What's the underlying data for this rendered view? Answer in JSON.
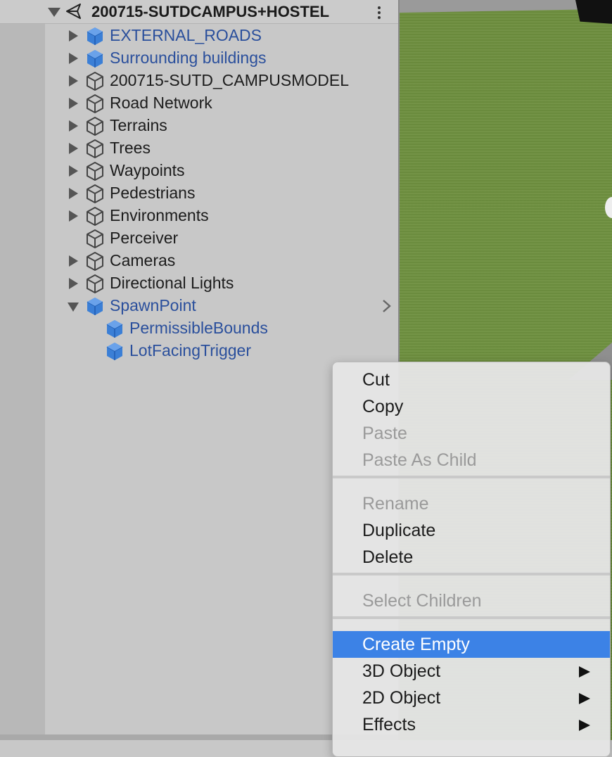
{
  "hierarchy": {
    "scene_title": "200715-SUTDCAMPUS+HOSTEL",
    "items": [
      {
        "label": "EXTERNAL_ROADS",
        "prefab": true,
        "expander": "right",
        "depth": 0
      },
      {
        "label": "Surrounding buildings",
        "prefab": true,
        "expander": "right",
        "depth": 0
      },
      {
        "label": "200715-SUTD_CAMPUSMODEL",
        "prefab": false,
        "expander": "right",
        "depth": 0
      },
      {
        "label": "Road Network",
        "prefab": false,
        "expander": "right",
        "depth": 0
      },
      {
        "label": "Terrains",
        "prefab": false,
        "expander": "right",
        "depth": 0
      },
      {
        "label": "Trees",
        "prefab": false,
        "expander": "right",
        "depth": 0
      },
      {
        "label": "Waypoints",
        "prefab": false,
        "expander": "right",
        "depth": 0
      },
      {
        "label": "Pedestrians",
        "prefab": false,
        "expander": "right",
        "depth": 0
      },
      {
        "label": "Environments",
        "prefab": false,
        "expander": "right",
        "depth": 0
      },
      {
        "label": "Perceiver",
        "prefab": false,
        "expander": "none",
        "depth": 0
      },
      {
        "label": "Cameras",
        "prefab": false,
        "expander": "right",
        "depth": 0
      },
      {
        "label": "Directional Lights",
        "prefab": false,
        "expander": "right",
        "depth": 0
      },
      {
        "label": "SpawnPoint",
        "prefab": true,
        "expander": "down",
        "depth": 0
      },
      {
        "label": "PermissibleBounds",
        "prefab": true,
        "expander": "none",
        "depth": 1
      },
      {
        "label": "LotFacingTrigger",
        "prefab": true,
        "expander": "none",
        "depth": 1
      }
    ]
  },
  "context_menu": {
    "items": [
      {
        "label": "Cut",
        "disabled": false
      },
      {
        "label": "Copy",
        "disabled": false
      },
      {
        "label": "Paste",
        "disabled": true
      },
      {
        "label": "Paste As Child",
        "disabled": true
      },
      {
        "separator": true
      },
      {
        "label": "Rename",
        "disabled": true
      },
      {
        "label": "Duplicate",
        "disabled": false
      },
      {
        "label": "Delete",
        "disabled": false
      },
      {
        "separator": true
      },
      {
        "label": "Select Children",
        "disabled": true
      },
      {
        "separator": true
      },
      {
        "label": "Create Empty",
        "disabled": false,
        "active": true
      },
      {
        "label": "3D Object",
        "disabled": false,
        "submenu": true
      },
      {
        "label": "2D Object",
        "disabled": false,
        "submenu": true
      },
      {
        "label": "Effects",
        "disabled": false,
        "submenu": true
      }
    ]
  },
  "colors": {
    "prefab_text": "#2a4f9c",
    "selection": "#3c82e6",
    "prefab_icon": "#3b7fd6"
  }
}
